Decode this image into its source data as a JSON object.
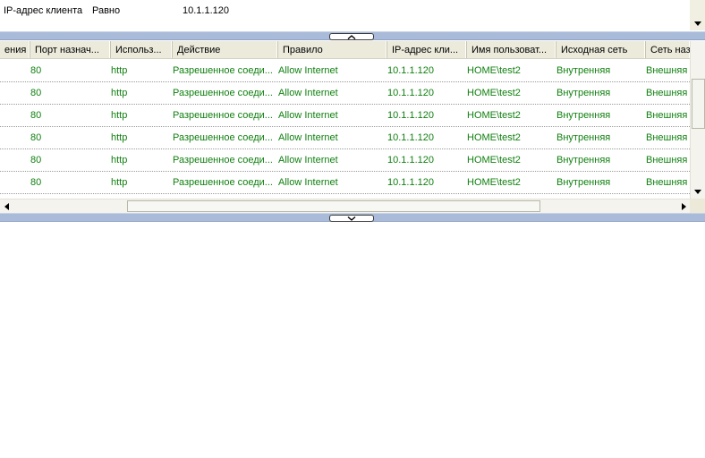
{
  "filter": {
    "field": "IP-адрес клиента",
    "condition": "Равно",
    "value": "10.1.1.120"
  },
  "grid": {
    "columns": [
      "ения",
      "Порт назнач...",
      "Использ...",
      "Действие",
      "Правило",
      "IP-адрес кли...",
      "Имя пользоват...",
      "Исходная сеть",
      "Сеть наз"
    ],
    "rows": [
      [
        "",
        "80",
        "http",
        "Разрешенное соеди...",
        "Allow Internet",
        "10.1.1.120",
        "HOME\\test2",
        "Внутренняя",
        "Внешняя"
      ],
      [
        "",
        "80",
        "http",
        "Разрешенное соеди...",
        "Allow Internet",
        "10.1.1.120",
        "HOME\\test2",
        "Внутренняя",
        "Внешняя"
      ],
      [
        "",
        "80",
        "http",
        "Разрешенное соеди...",
        "Allow Internet",
        "10.1.1.120",
        "HOME\\test2",
        "Внутренняя",
        "Внешняя"
      ],
      [
        "",
        "80",
        "http",
        "Разрешенное соеди...",
        "Allow Internet",
        "10.1.1.120",
        "HOME\\test2",
        "Внутренняя",
        "Внешняя"
      ],
      [
        "",
        "80",
        "http",
        "Разрешенное соеди...",
        "Allow Internet",
        "10.1.1.120",
        "HOME\\test2",
        "Внутренняя",
        "Внешняя"
      ],
      [
        "",
        "80",
        "http",
        "Разрешенное соеди...",
        "Allow Internet",
        "10.1.1.120",
        "HOME\\test2",
        "Внутренняя",
        "Внешняя"
      ]
    ]
  },
  "icons": {
    "splitter_top": "chevron-up-icon",
    "splitter_bottom": "chevron-down-icon",
    "scroll_up": "arrow-up-icon",
    "scroll_down": "arrow-down-icon",
    "scroll_left": "arrow-left-icon",
    "scroll_right": "arrow-right-icon"
  },
  "colors": {
    "row_text": "#108010",
    "splitter": "#a9bbd8",
    "header_bg": "#ebeadb"
  }
}
